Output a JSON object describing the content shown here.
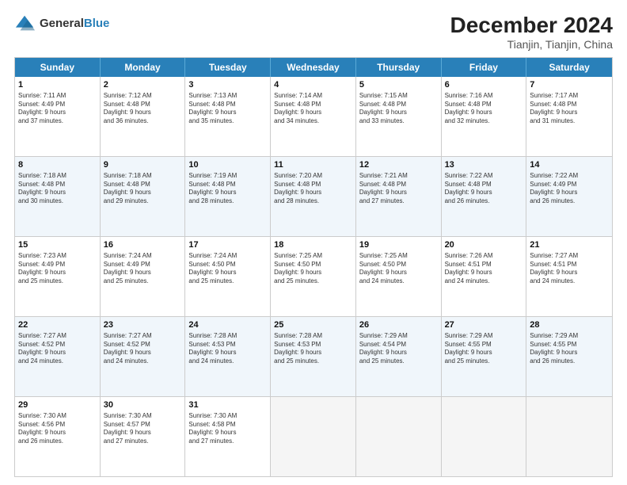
{
  "header": {
    "logo_general": "General",
    "logo_blue": "Blue",
    "title": "December 2024",
    "location": "Tianjin, Tianjin, China"
  },
  "weekdays": [
    "Sunday",
    "Monday",
    "Tuesday",
    "Wednesday",
    "Thursday",
    "Friday",
    "Saturday"
  ],
  "rows": [
    {
      "alt": false,
      "cells": [
        {
          "day": "1",
          "lines": [
            "Sunrise: 7:11 AM",
            "Sunset: 4:49 PM",
            "Daylight: 9 hours",
            "and 37 minutes."
          ]
        },
        {
          "day": "2",
          "lines": [
            "Sunrise: 7:12 AM",
            "Sunset: 4:48 PM",
            "Daylight: 9 hours",
            "and 36 minutes."
          ]
        },
        {
          "day": "3",
          "lines": [
            "Sunrise: 7:13 AM",
            "Sunset: 4:48 PM",
            "Daylight: 9 hours",
            "and 35 minutes."
          ]
        },
        {
          "day": "4",
          "lines": [
            "Sunrise: 7:14 AM",
            "Sunset: 4:48 PM",
            "Daylight: 9 hours",
            "and 34 minutes."
          ]
        },
        {
          "day": "5",
          "lines": [
            "Sunrise: 7:15 AM",
            "Sunset: 4:48 PM",
            "Daylight: 9 hours",
            "and 33 minutes."
          ]
        },
        {
          "day": "6",
          "lines": [
            "Sunrise: 7:16 AM",
            "Sunset: 4:48 PM",
            "Daylight: 9 hours",
            "and 32 minutes."
          ]
        },
        {
          "day": "7",
          "lines": [
            "Sunrise: 7:17 AM",
            "Sunset: 4:48 PM",
            "Daylight: 9 hours",
            "and 31 minutes."
          ]
        }
      ]
    },
    {
      "alt": true,
      "cells": [
        {
          "day": "8",
          "lines": [
            "Sunrise: 7:18 AM",
            "Sunset: 4:48 PM",
            "Daylight: 9 hours",
            "and 30 minutes."
          ]
        },
        {
          "day": "9",
          "lines": [
            "Sunrise: 7:18 AM",
            "Sunset: 4:48 PM",
            "Daylight: 9 hours",
            "and 29 minutes."
          ]
        },
        {
          "day": "10",
          "lines": [
            "Sunrise: 7:19 AM",
            "Sunset: 4:48 PM",
            "Daylight: 9 hours",
            "and 28 minutes."
          ]
        },
        {
          "day": "11",
          "lines": [
            "Sunrise: 7:20 AM",
            "Sunset: 4:48 PM",
            "Daylight: 9 hours",
            "and 28 minutes."
          ]
        },
        {
          "day": "12",
          "lines": [
            "Sunrise: 7:21 AM",
            "Sunset: 4:48 PM",
            "Daylight: 9 hours",
            "and 27 minutes."
          ]
        },
        {
          "day": "13",
          "lines": [
            "Sunrise: 7:22 AM",
            "Sunset: 4:48 PM",
            "Daylight: 9 hours",
            "and 26 minutes."
          ]
        },
        {
          "day": "14",
          "lines": [
            "Sunrise: 7:22 AM",
            "Sunset: 4:49 PM",
            "Daylight: 9 hours",
            "and 26 minutes."
          ]
        }
      ]
    },
    {
      "alt": false,
      "cells": [
        {
          "day": "15",
          "lines": [
            "Sunrise: 7:23 AM",
            "Sunset: 4:49 PM",
            "Daylight: 9 hours",
            "and 25 minutes."
          ]
        },
        {
          "day": "16",
          "lines": [
            "Sunrise: 7:24 AM",
            "Sunset: 4:49 PM",
            "Daylight: 9 hours",
            "and 25 minutes."
          ]
        },
        {
          "day": "17",
          "lines": [
            "Sunrise: 7:24 AM",
            "Sunset: 4:50 PM",
            "Daylight: 9 hours",
            "and 25 minutes."
          ]
        },
        {
          "day": "18",
          "lines": [
            "Sunrise: 7:25 AM",
            "Sunset: 4:50 PM",
            "Daylight: 9 hours",
            "and 25 minutes."
          ]
        },
        {
          "day": "19",
          "lines": [
            "Sunrise: 7:25 AM",
            "Sunset: 4:50 PM",
            "Daylight: 9 hours",
            "and 24 minutes."
          ]
        },
        {
          "day": "20",
          "lines": [
            "Sunrise: 7:26 AM",
            "Sunset: 4:51 PM",
            "Daylight: 9 hours",
            "and 24 minutes."
          ]
        },
        {
          "day": "21",
          "lines": [
            "Sunrise: 7:27 AM",
            "Sunset: 4:51 PM",
            "Daylight: 9 hours",
            "and 24 minutes."
          ]
        }
      ]
    },
    {
      "alt": true,
      "cells": [
        {
          "day": "22",
          "lines": [
            "Sunrise: 7:27 AM",
            "Sunset: 4:52 PM",
            "Daylight: 9 hours",
            "and 24 minutes."
          ]
        },
        {
          "day": "23",
          "lines": [
            "Sunrise: 7:27 AM",
            "Sunset: 4:52 PM",
            "Daylight: 9 hours",
            "and 24 minutes."
          ]
        },
        {
          "day": "24",
          "lines": [
            "Sunrise: 7:28 AM",
            "Sunset: 4:53 PM",
            "Daylight: 9 hours",
            "and 24 minutes."
          ]
        },
        {
          "day": "25",
          "lines": [
            "Sunrise: 7:28 AM",
            "Sunset: 4:53 PM",
            "Daylight: 9 hours",
            "and 25 minutes."
          ]
        },
        {
          "day": "26",
          "lines": [
            "Sunrise: 7:29 AM",
            "Sunset: 4:54 PM",
            "Daylight: 9 hours",
            "and 25 minutes."
          ]
        },
        {
          "day": "27",
          "lines": [
            "Sunrise: 7:29 AM",
            "Sunset: 4:55 PM",
            "Daylight: 9 hours",
            "and 25 minutes."
          ]
        },
        {
          "day": "28",
          "lines": [
            "Sunrise: 7:29 AM",
            "Sunset: 4:55 PM",
            "Daylight: 9 hours",
            "and 26 minutes."
          ]
        }
      ]
    },
    {
      "alt": false,
      "cells": [
        {
          "day": "29",
          "lines": [
            "Sunrise: 7:30 AM",
            "Sunset: 4:56 PM",
            "Daylight: 9 hours",
            "and 26 minutes."
          ]
        },
        {
          "day": "30",
          "lines": [
            "Sunrise: 7:30 AM",
            "Sunset: 4:57 PM",
            "Daylight: 9 hours",
            "and 27 minutes."
          ]
        },
        {
          "day": "31",
          "lines": [
            "Sunrise: 7:30 AM",
            "Sunset: 4:58 PM",
            "Daylight: 9 hours",
            "and 27 minutes."
          ]
        },
        {
          "day": "",
          "lines": []
        },
        {
          "day": "",
          "lines": []
        },
        {
          "day": "",
          "lines": []
        },
        {
          "day": "",
          "lines": []
        }
      ]
    }
  ]
}
